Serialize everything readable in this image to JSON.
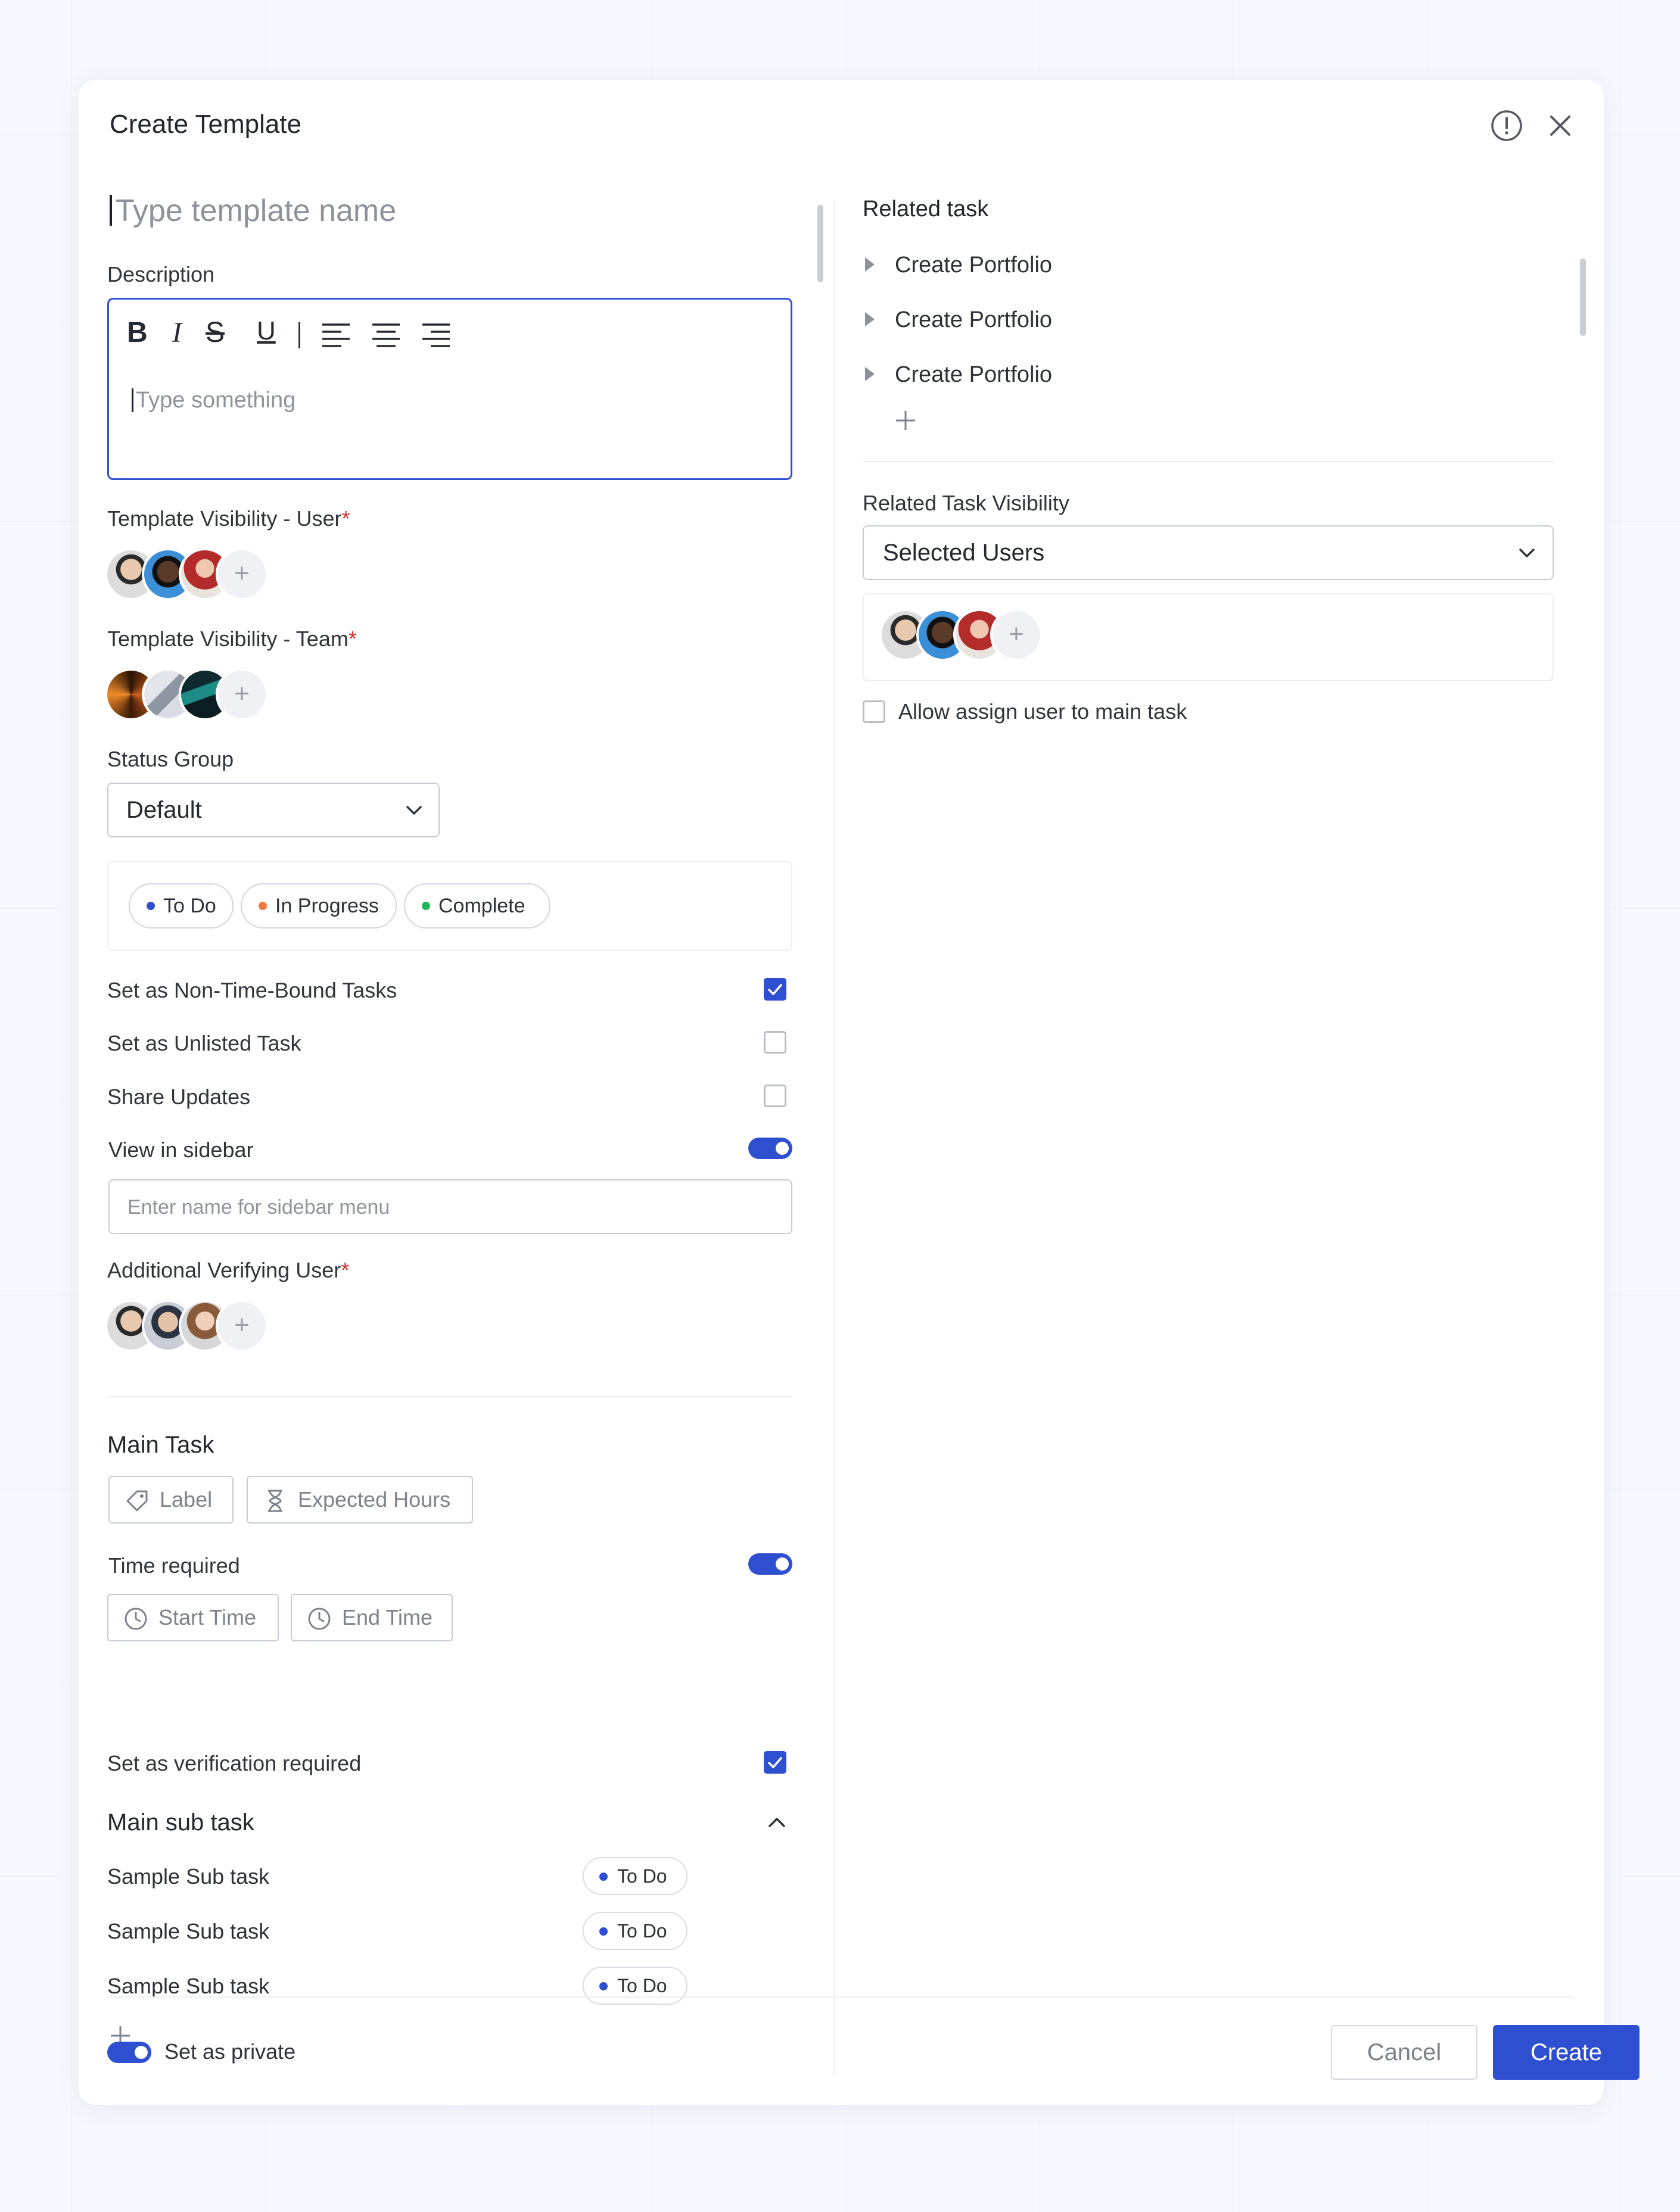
{
  "dialog": {
    "title": "Create Template",
    "info_icon": "info-icon",
    "close_icon": "close-icon"
  },
  "left": {
    "template_name_placeholder": "Type template name",
    "description_label": "Description",
    "editor": {
      "toolbar": [
        {
          "icon": "bold-icon",
          "glyph": "B"
        },
        {
          "icon": "italic-icon",
          "glyph": "I"
        },
        {
          "icon": "strikethrough-icon",
          "glyph": "S"
        },
        {
          "icon": "underline-icon",
          "glyph": "U"
        },
        {
          "icon": "align-left-icon"
        },
        {
          "icon": "align-center-icon"
        },
        {
          "icon": "align-right-icon"
        }
      ],
      "placeholder": "Type something"
    },
    "visibility_user": {
      "label": "Template Visibility - User",
      "required": "*",
      "add": "+"
    },
    "visibility_team": {
      "label": "Template Visibility - Team",
      "required": "*",
      "add": "+"
    },
    "status_group": {
      "label": "Status Group",
      "value": "Default",
      "statuses": [
        {
          "label": "To Do",
          "color": "#2f4fd1"
        },
        {
          "label": "In Progress",
          "color": "#f07a3a"
        },
        {
          "label": "Complete",
          "color": "#22b85a"
        }
      ]
    },
    "options": [
      {
        "label": "Set as Non-Time-Bound Tasks",
        "checked": true
      },
      {
        "label": "Set as Unlisted Task",
        "checked": false
      },
      {
        "label": "Share Updates",
        "checked": false
      }
    ],
    "view_in_sidebar": {
      "label": "View in sidebar",
      "on": true
    },
    "sidebar_name_placeholder": "Enter name for sidebar menu",
    "verifying_user": {
      "label": "Additional Verifying User",
      "required": "*",
      "add": "+"
    },
    "main_task": {
      "title": "Main Task",
      "label_button": "Label",
      "hours_button": "Expected Hours",
      "time_required": {
        "label": "Time required",
        "on": true
      },
      "start_time": "Start Time",
      "end_time": "End Time",
      "verification": {
        "label": "Set as verification required",
        "checked": true
      }
    },
    "main_sub_task": {
      "title": "Main sub task",
      "items": [
        {
          "name": "Sample Sub task",
          "status": "To Do"
        },
        {
          "name": "Sample Sub task",
          "status": "To Do"
        },
        {
          "name": "Sample Sub task",
          "status": "To Do"
        }
      ]
    }
  },
  "right": {
    "related_task_title": "Related task",
    "related_tasks": [
      "Create Portfolio",
      "Create Portfolio",
      "Create Portfolio"
    ],
    "visibility_label": "Related Task Visibility",
    "visibility_value": "Selected Users",
    "allow_assign": {
      "label": "Allow assign user to main task",
      "checked": false
    },
    "add": "+"
  },
  "footer": {
    "private": {
      "label": "Set as private",
      "on": true
    },
    "cancel": "Cancel",
    "create": "Create"
  },
  "colors": {
    "accent": "#2f4fd1",
    "required": "#d0342c"
  }
}
